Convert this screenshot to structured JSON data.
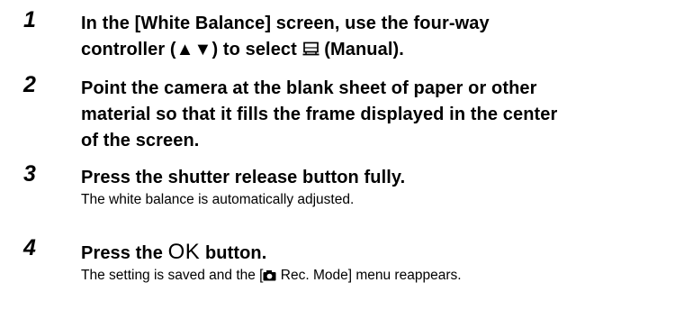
{
  "steps": [
    {
      "number": "1",
      "heading": {
        "line1": "In the [White Balance] screen, use the four-way",
        "line2_before": "controller (▲▼) to select ",
        "line2_after": " (Manual)."
      },
      "icon": "manual-white-balance-icon"
    },
    {
      "number": "2",
      "heading": {
        "line1": "Point the camera at the blank sheet of paper or other",
        "line2": "material so that it fills the frame displayed in the center",
        "line3": "of the screen."
      }
    },
    {
      "number": "3",
      "heading": {
        "line1": "Press the shutter release button fully."
      },
      "description": "The white balance is automatically adjusted."
    },
    {
      "number": "4",
      "heading": {
        "before": "Press the ",
        "ok": "OK",
        "after": " button."
      },
      "description_before": "The setting is saved and the [",
      "description_after": " Rec. Mode] menu reappears.",
      "icon": "camera-icon"
    }
  ]
}
